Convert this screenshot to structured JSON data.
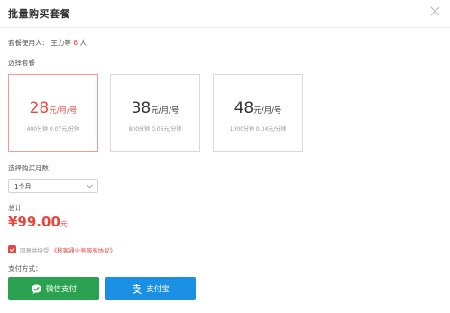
{
  "dialog": {
    "title": "批量购买套餐"
  },
  "users": {
    "label": "套餐使用人：",
    "names": "王力等",
    "count": "6",
    "unit": "人"
  },
  "plans": {
    "section_label": "选择套餐",
    "items": [
      {
        "price": "28",
        "unit": "元/月/号",
        "minutes": "400分钟",
        "rate": "0.07元/分钟",
        "selected": true
      },
      {
        "price": "38",
        "unit": "元/月/号",
        "minutes": "800分钟",
        "rate": "0.06元/分钟",
        "selected": false
      },
      {
        "price": "48",
        "unit": "元/月/号",
        "minutes": "1000分钟",
        "rate": "0.04元/分钟",
        "selected": false
      }
    ]
  },
  "months": {
    "section_label": "选择购买月数",
    "selected": "1个月"
  },
  "total": {
    "label": "总计",
    "amount": "¥99.00",
    "unit": "元"
  },
  "agreement": {
    "checked": true,
    "prefix": "同意并接受",
    "link": "《移客通业务服务协议》"
  },
  "payment": {
    "label": "支付方式：",
    "wechat": "微信支付",
    "alipay": "支付宝"
  },
  "colors": {
    "accent": "#e8473f",
    "wechat": "#2aa24f",
    "alipay": "#1b8fe3"
  },
  "icons": [
    "close-icon",
    "chevron-down-icon",
    "check-icon",
    "wechat-icon",
    "alipay-icon"
  ]
}
